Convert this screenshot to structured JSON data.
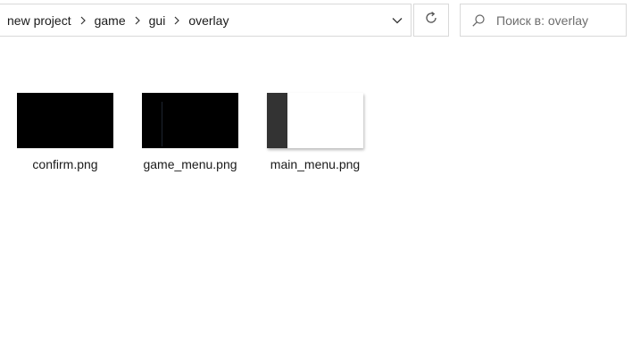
{
  "breadcrumb": {
    "items": [
      {
        "label": "new project"
      },
      {
        "label": "game"
      },
      {
        "label": "gui"
      },
      {
        "label": "overlay"
      }
    ]
  },
  "search": {
    "placeholder": "Поиск в: overlay",
    "value": ""
  },
  "icons": {
    "separator": "chevron-right-icon",
    "dropdown": "chevron-down-icon",
    "refresh": "refresh-icon",
    "search": "search-icon"
  },
  "files": [
    {
      "name": "confirm.png",
      "thumbnail": "black"
    },
    {
      "name": "game_menu.png",
      "thumbnail": "black"
    },
    {
      "name": "main_menu.png",
      "thumbnail": "white-with-dark-sidebar"
    }
  ]
}
